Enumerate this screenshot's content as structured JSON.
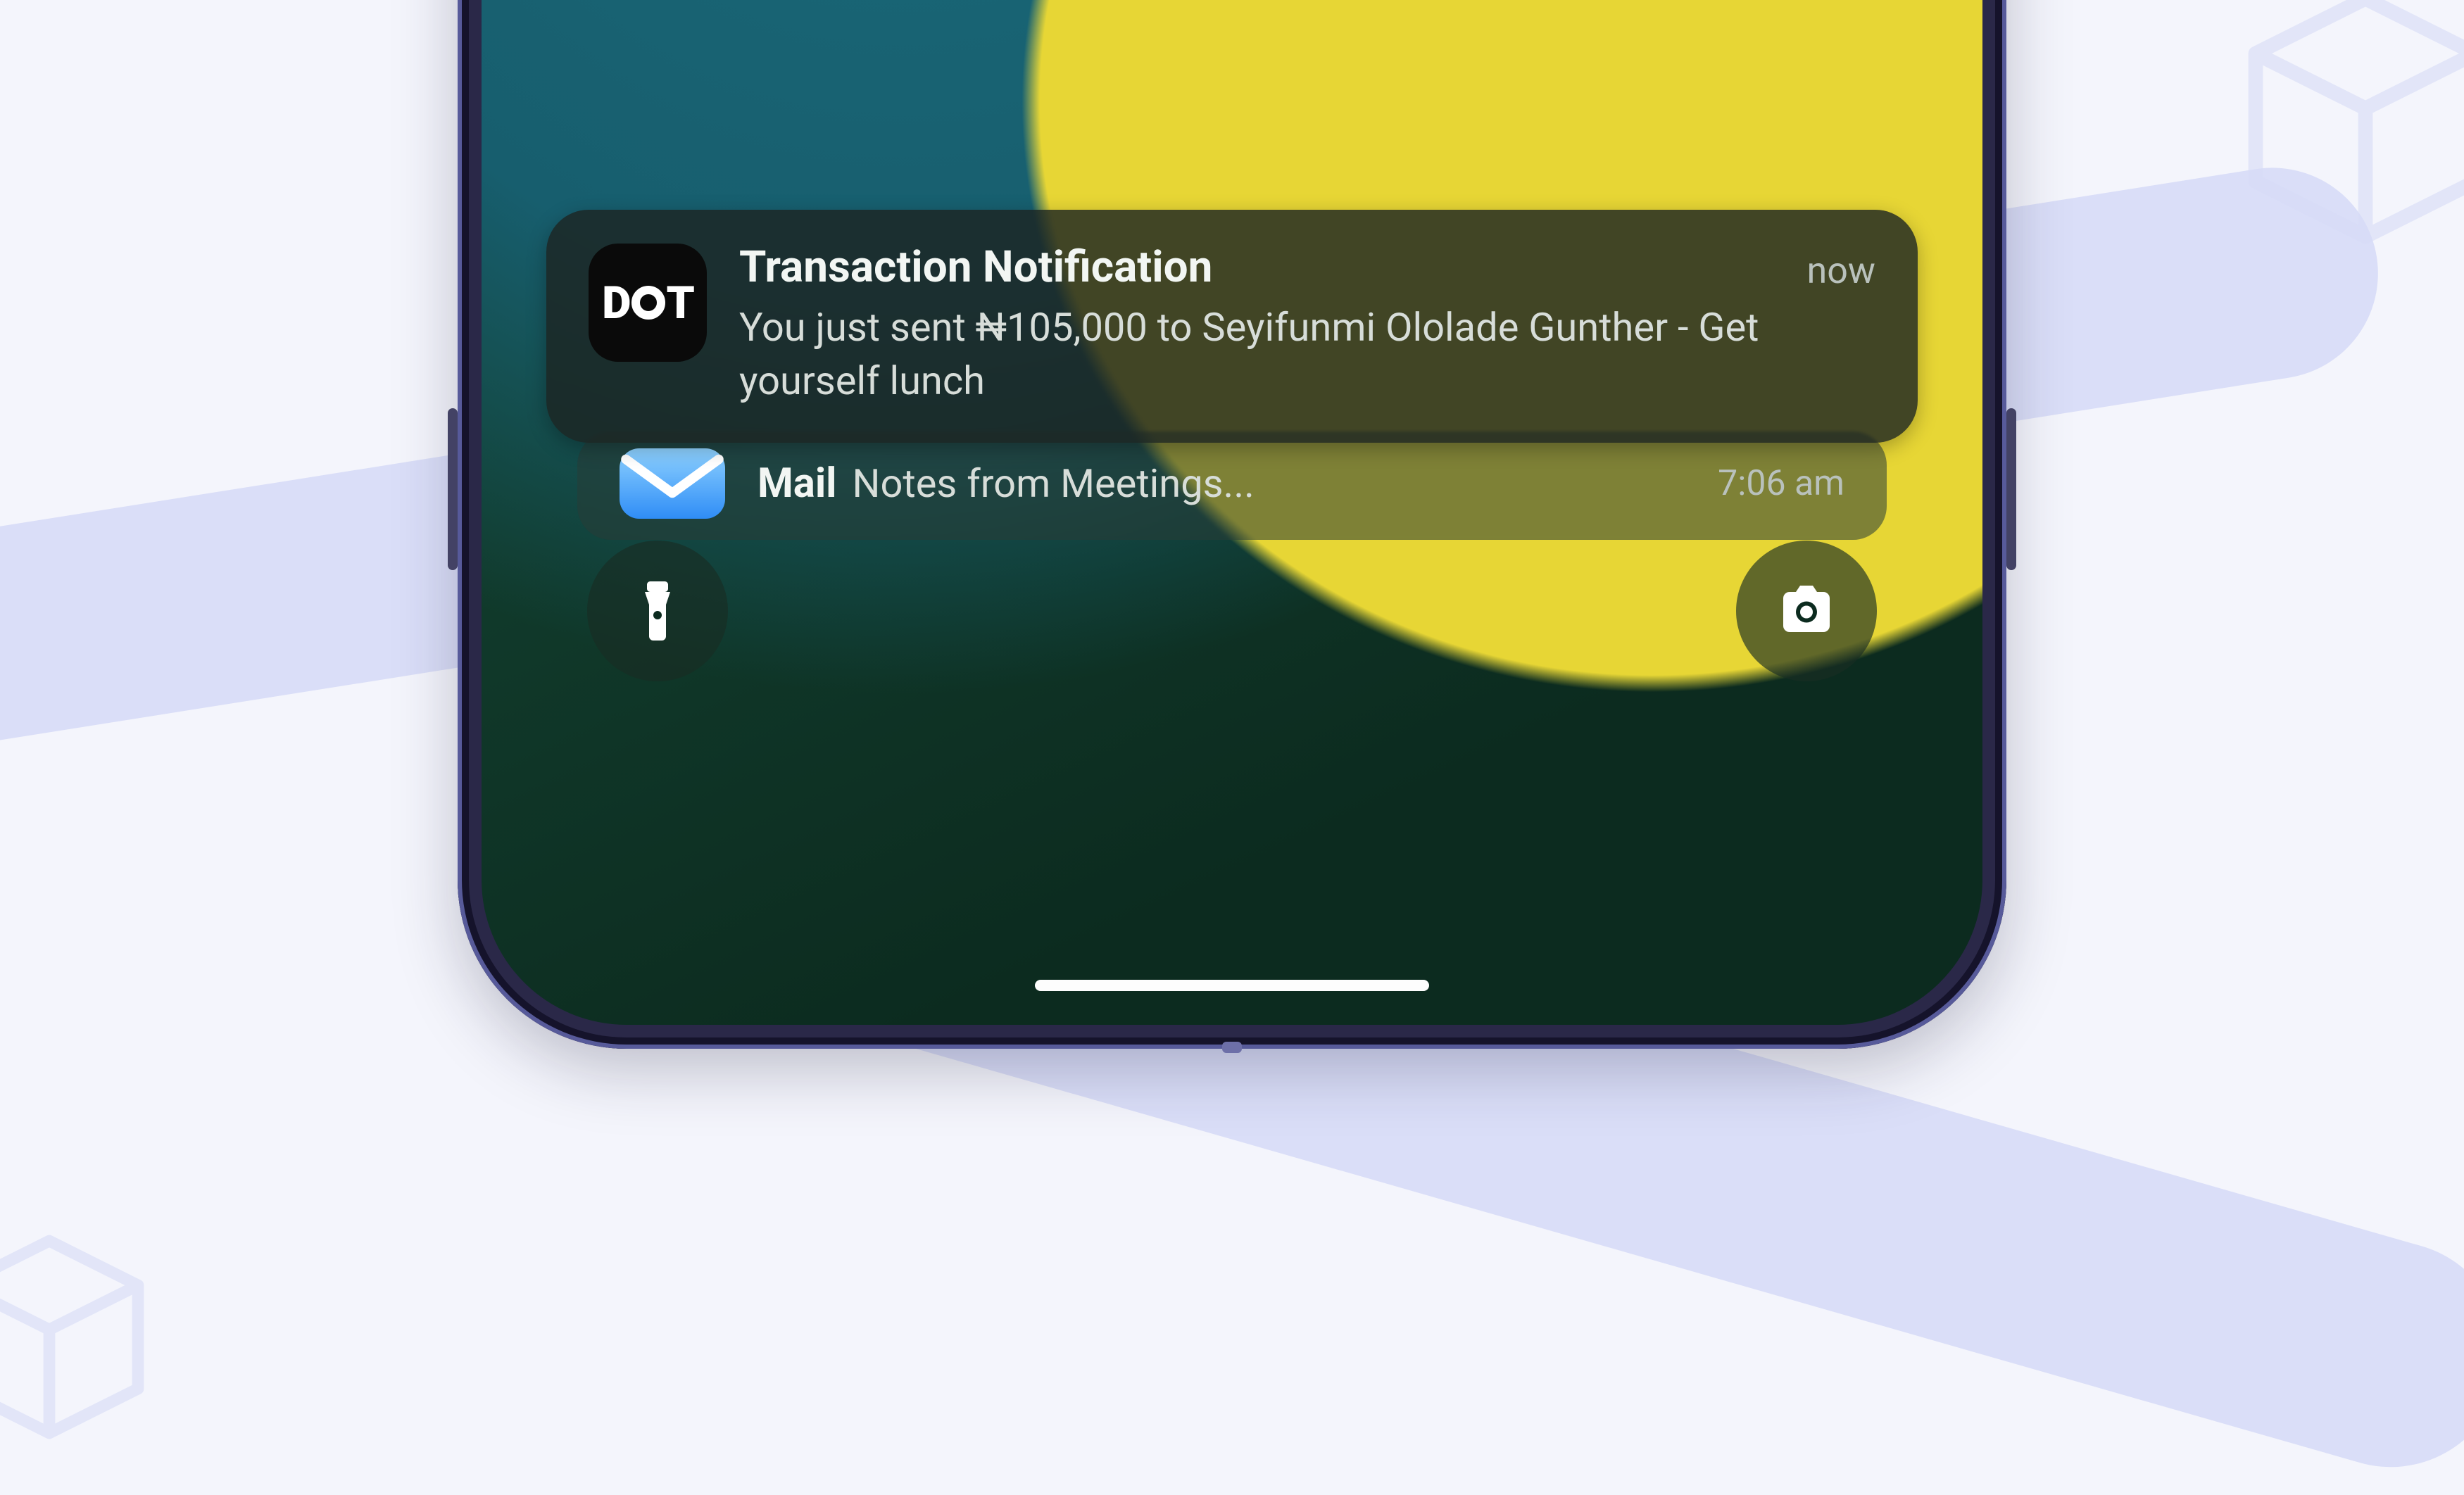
{
  "notification_primary": {
    "app_icon_name": "dot-app-icon",
    "title": "Transaction Notification",
    "message": "You just sent ₦105,000 to Seyifunmi Ololade Gunther - Get yourself lunch",
    "time": "now"
  },
  "notification_secondary": {
    "app_icon_name": "mail-app-icon",
    "app_label": "Mail",
    "subject": "Notes from Meetings...",
    "time": "7:06 am"
  },
  "quick_actions": {
    "left": "flashlight",
    "right": "camera"
  }
}
